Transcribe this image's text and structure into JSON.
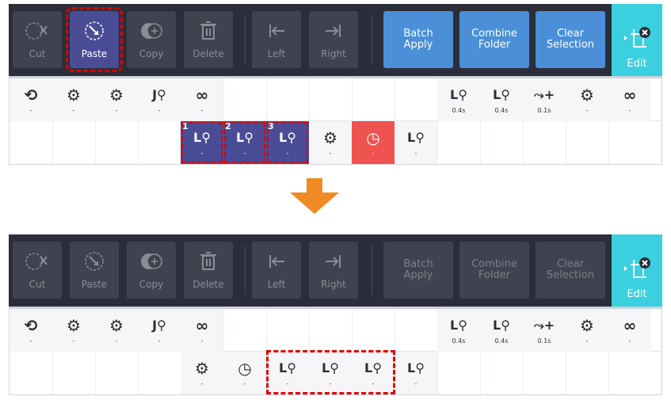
{
  "toolbar_buttons": {
    "cut": "Cut",
    "paste": "Paste",
    "copy": "Copy",
    "delete": "Delete",
    "left": "Left",
    "right": "Right"
  },
  "actions": {
    "batch_apply": "Batch\nApply",
    "combine_folder": "Combine\nFolder",
    "clear_selection": "Clear\nSelection",
    "edit": "Edit"
  },
  "cell_values": {
    "dash": "-",
    "t04": "0.4s",
    "t01": "0.1s"
  },
  "selection_numbers": [
    "1",
    "2",
    "3"
  ],
  "colors": {
    "toolbar_bg": "#2b2e3a",
    "accent_blue": "#4a8fd8",
    "edit_cyan": "#3bd0e0",
    "selected_purple": "#4a4d95",
    "timer_red": "#ef5350",
    "highlight_red": "#e00000",
    "arrow_orange": "#f08a24"
  },
  "icons": {
    "cut": "scissors-icon",
    "paste": "paste-icon",
    "copy": "copy-icon",
    "delete": "trash-icon",
    "left": "arrow-left-bar-icon",
    "right": "arrow-right-bar-icon",
    "edit": "crop-edit-icon",
    "grid": [
      "rotate-icon",
      "gear-icon",
      "location-pin-path-icon",
      "infinity-loop-icon",
      "timer-icon",
      "route-add-icon"
    ]
  }
}
